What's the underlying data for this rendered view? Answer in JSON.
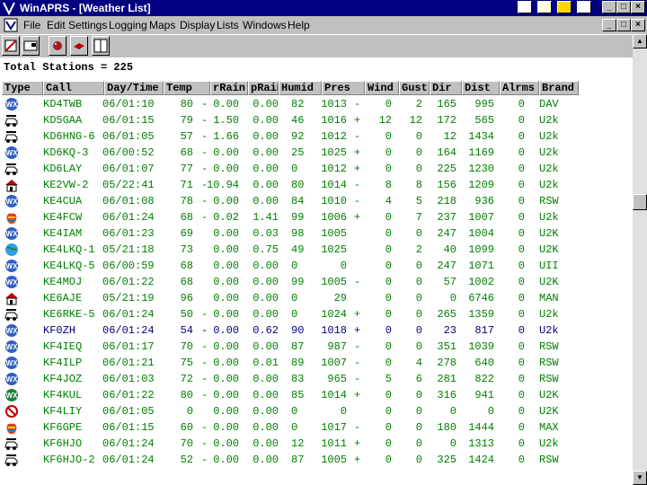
{
  "window": {
    "title": "WinAPRS - [Weather List]"
  },
  "menu": [
    "File",
    "Edit",
    "Settings",
    "Logging",
    "Maps",
    "Display",
    "Lists",
    "Windows",
    "Help"
  ],
  "summary": "Total Stations = 225",
  "columns": [
    "Type",
    "Call",
    "Day/Time",
    "Temp",
    "rRain",
    "pRain",
    "Humid",
    "Pres",
    "Wind",
    "Gust",
    "Dir",
    "Dist",
    "Alrms",
    "Brand"
  ],
  "colors": {
    "title_bar": "#000080",
    "row_text": "#008000",
    "selected_text": "#000080"
  },
  "rows": [
    {
      "icon": "wx-icon",
      "call": "KD4TWB",
      "time": "06/01:10",
      "temp": "80",
      "tt": "-",
      "rrain": "0.00",
      "prain": "0.00",
      "humid": "82",
      "pres": "1013",
      "pt": "-",
      "wind": "0",
      "gust": "2",
      "dir": "165",
      "dist": "995",
      "alrms": "0",
      "brand": "DAV"
    },
    {
      "icon": "car-icon",
      "call": "KD5GAA",
      "time": "06/01:15",
      "temp": "79",
      "tt": "-",
      "rrain": "1.50",
      "prain": "0.00",
      "humid": "46",
      "pres": "1016",
      "pt": "+",
      "wind": "12",
      "gust": "12",
      "dir": "172",
      "dist": "565",
      "alrms": "0",
      "brand": "U2k"
    },
    {
      "icon": "car-icon",
      "call": "KD6HNG-6",
      "time": "06/01:05",
      "temp": "57",
      "tt": "-",
      "rrain": "1.66",
      "prain": "0.00",
      "humid": "92",
      "pres": "1012",
      "pt": "-",
      "wind": "0",
      "gust": "0",
      "dir": "12",
      "dist": "1434",
      "alrms": "0",
      "brand": "U2k"
    },
    {
      "icon": "wx-icon",
      "call": "KD6KQ-3",
      "time": "06/00:52",
      "temp": "68",
      "tt": "-",
      "rrain": "0.00",
      "prain": "0.00",
      "humid": "25",
      "pres": "1025",
      "pt": "+",
      "wind": "0",
      "gust": "0",
      "dir": "164",
      "dist": "1169",
      "alrms": "0",
      "brand": "U2k"
    },
    {
      "icon": "car-icon",
      "call": "KD6LAY",
      "time": "06/01:07",
      "temp": "77",
      "tt": "-",
      "rrain": "0.00",
      "prain": "0.00",
      "humid": "0",
      "pres": "1012",
      "pt": "+",
      "wind": "0",
      "gust": "0",
      "dir": "225",
      "dist": "1230",
      "alrms": "0",
      "brand": "U2k"
    },
    {
      "icon": "house-icon",
      "call": "KE2VW-2",
      "time": "05/22:41",
      "temp": "71",
      "tt": "-",
      "rrain": "10.94",
      "prain": "0.00",
      "humid": "80",
      "pres": "1014",
      "pt": "-",
      "wind": "8",
      "gust": "8",
      "dir": "156",
      "dist": "1209",
      "alrms": "0",
      "brand": "U2k"
    },
    {
      "icon": "wx-icon",
      "call": "KE4CUA",
      "time": "06/01:08",
      "temp": "78",
      "tt": "-",
      "rrain": "0.00",
      "prain": "0.00",
      "humid": "84",
      "pres": "1010",
      "pt": "-",
      "wind": "4",
      "gust": "5",
      "dir": "218",
      "dist": "936",
      "alrms": "0",
      "brand": "RSW"
    },
    {
      "icon": "apple-icon",
      "call": "KE4FCW",
      "time": "06/01:24",
      "temp": "68",
      "tt": "-",
      "rrain": "0.02",
      "prain": "1.41",
      "humid": "99",
      "pres": "1006",
      "pt": "+",
      "wind": "0",
      "gust": "7",
      "dir": "237",
      "dist": "1007",
      "alrms": "0",
      "brand": "U2k"
    },
    {
      "icon": "wx-icon",
      "call": "KE4IAM",
      "time": "06/01:23",
      "temp": "69",
      "tt": "",
      "rrain": "0.00",
      "prain": "0.03",
      "humid": "98",
      "pres": "1005",
      "pt": "",
      "wind": "0",
      "gust": "0",
      "dir": "247",
      "dist": "1004",
      "alrms": "0",
      "brand": "U2K"
    },
    {
      "icon": "globe-icon",
      "call": "KE4LKQ-1",
      "time": "05/21:18",
      "temp": "73",
      "tt": "",
      "rrain": "0.00",
      "prain": "0.75",
      "humid": "49",
      "pres": "1025",
      "pt": "",
      "wind": "0",
      "gust": "2",
      "dir": "40",
      "dist": "1099",
      "alrms": "0",
      "brand": "U2K"
    },
    {
      "icon": "wx-icon",
      "call": "KE4LKQ-5",
      "time": "06/00:59",
      "temp": "68",
      "tt": "",
      "rrain": "0.00",
      "prain": "0.00",
      "humid": "0",
      "pres": "0",
      "pt": "",
      "wind": "0",
      "gust": "0",
      "dir": "247",
      "dist": "1071",
      "alrms": "0",
      "brand": "UII"
    },
    {
      "icon": "wx-icon",
      "call": "KE4MOJ",
      "time": "06/01:22",
      "temp": "68",
      "tt": "",
      "rrain": "0.00",
      "prain": "0.00",
      "humid": "99",
      "pres": "1005",
      "pt": "-",
      "wind": "0",
      "gust": "0",
      "dir": "57",
      "dist": "1002",
      "alrms": "0",
      "brand": "U2K"
    },
    {
      "icon": "house-icon",
      "call": "KE6AJE",
      "time": "05/21:19",
      "temp": "96",
      "tt": "",
      "rrain": "0.00",
      "prain": "0.00",
      "humid": "0",
      "pres": "29",
      "pt": "",
      "wind": "0",
      "gust": "0",
      "dir": "0",
      "dist": "6746",
      "alrms": "0",
      "brand": "MAN"
    },
    {
      "icon": "car-icon",
      "call": "KE6RKE-5",
      "time": "06/01:24",
      "temp": "50",
      "tt": "-",
      "rrain": "0.00",
      "prain": "0.00",
      "humid": "0",
      "pres": "1024",
      "pt": "+",
      "wind": "0",
      "gust": "0",
      "dir": "265",
      "dist": "1359",
      "alrms": "0",
      "brand": "U2k"
    },
    {
      "icon": "wx-icon",
      "call": "KF0ZH",
      "time": "06/01:24",
      "temp": "54",
      "tt": "-",
      "rrain": "0.00",
      "prain": "0.62",
      "humid": "90",
      "pres": "1018",
      "pt": "+",
      "wind": "0",
      "gust": "0",
      "dir": "23",
      "dist": "817",
      "alrms": "0",
      "brand": "U2k",
      "selected": true
    },
    {
      "icon": "wx-icon",
      "call": "KF4IEQ",
      "time": "06/01:17",
      "temp": "70",
      "tt": "-",
      "rrain": "0.00",
      "prain": "0.00",
      "humid": "87",
      "pres": "987",
      "pt": "-",
      "wind": "0",
      "gust": "0",
      "dir": "351",
      "dist": "1039",
      "alrms": "0",
      "brand": "RSW"
    },
    {
      "icon": "wx-icon",
      "call": "KF4ILP",
      "time": "06/01:21",
      "temp": "75",
      "tt": "-",
      "rrain": "0.00",
      "prain": "0.01",
      "humid": "89",
      "pres": "1007",
      "pt": "-",
      "wind": "0",
      "gust": "4",
      "dir": "278",
      "dist": "640",
      "alrms": "0",
      "brand": "RSW"
    },
    {
      "icon": "wx-icon",
      "call": "KF4JOZ",
      "time": "06/01:03",
      "temp": "72",
      "tt": "-",
      "rrain": "0.00",
      "prain": "0.00",
      "humid": "83",
      "pres": "965",
      "pt": "-",
      "wind": "5",
      "gust": "6",
      "dir": "281",
      "dist": "822",
      "alrms": "0",
      "brand": "RSW"
    },
    {
      "icon": "wx-green-icon",
      "call": "KF4KUL",
      "time": "06/01:22",
      "temp": "80",
      "tt": "-",
      "rrain": "0.00",
      "prain": "0.00",
      "humid": "85",
      "pres": "1014",
      "pt": "+",
      "wind": "0",
      "gust": "0",
      "dir": "316",
      "dist": "941",
      "alrms": "0",
      "brand": "U2K"
    },
    {
      "icon": "no-symbol-icon",
      "call": "KF4LIY",
      "time": "06/01:05",
      "temp": "0",
      "tt": "",
      "rrain": "0.00",
      "prain": "0.00",
      "humid": "0",
      "pres": "0",
      "pt": "",
      "wind": "0",
      "gust": "0",
      "dir": "0",
      "dist": "0",
      "alrms": "0",
      "brand": "U2K"
    },
    {
      "icon": "apple-icon",
      "call": "KF6GPE",
      "time": "06/01:15",
      "temp": "60",
      "tt": "-",
      "rrain": "0.00",
      "prain": "0.00",
      "humid": "0",
      "pres": "1017",
      "pt": "-",
      "wind": "0",
      "gust": "0",
      "dir": "180",
      "dist": "1444",
      "alrms": "0",
      "brand": "MAX"
    },
    {
      "icon": "car-icon",
      "call": "KF6HJO",
      "time": "06/01:24",
      "temp": "70",
      "tt": "-",
      "rrain": "0.00",
      "prain": "0.00",
      "humid": "12",
      "pres": "1011",
      "pt": "+",
      "wind": "0",
      "gust": "0",
      "dir": "0",
      "dist": "1313",
      "alrms": "0",
      "brand": "U2k"
    },
    {
      "icon": "car-icon",
      "call": "KF6HJO-2",
      "time": "06/01:24",
      "temp": "52",
      "tt": "-",
      "rrain": "0.00",
      "prain": "0.00",
      "humid": "87",
      "pres": "1005",
      "pt": "+",
      "wind": "0",
      "gust": "0",
      "dir": "325",
      "dist": "1424",
      "alrms": "0",
      "brand": "RSW"
    }
  ]
}
